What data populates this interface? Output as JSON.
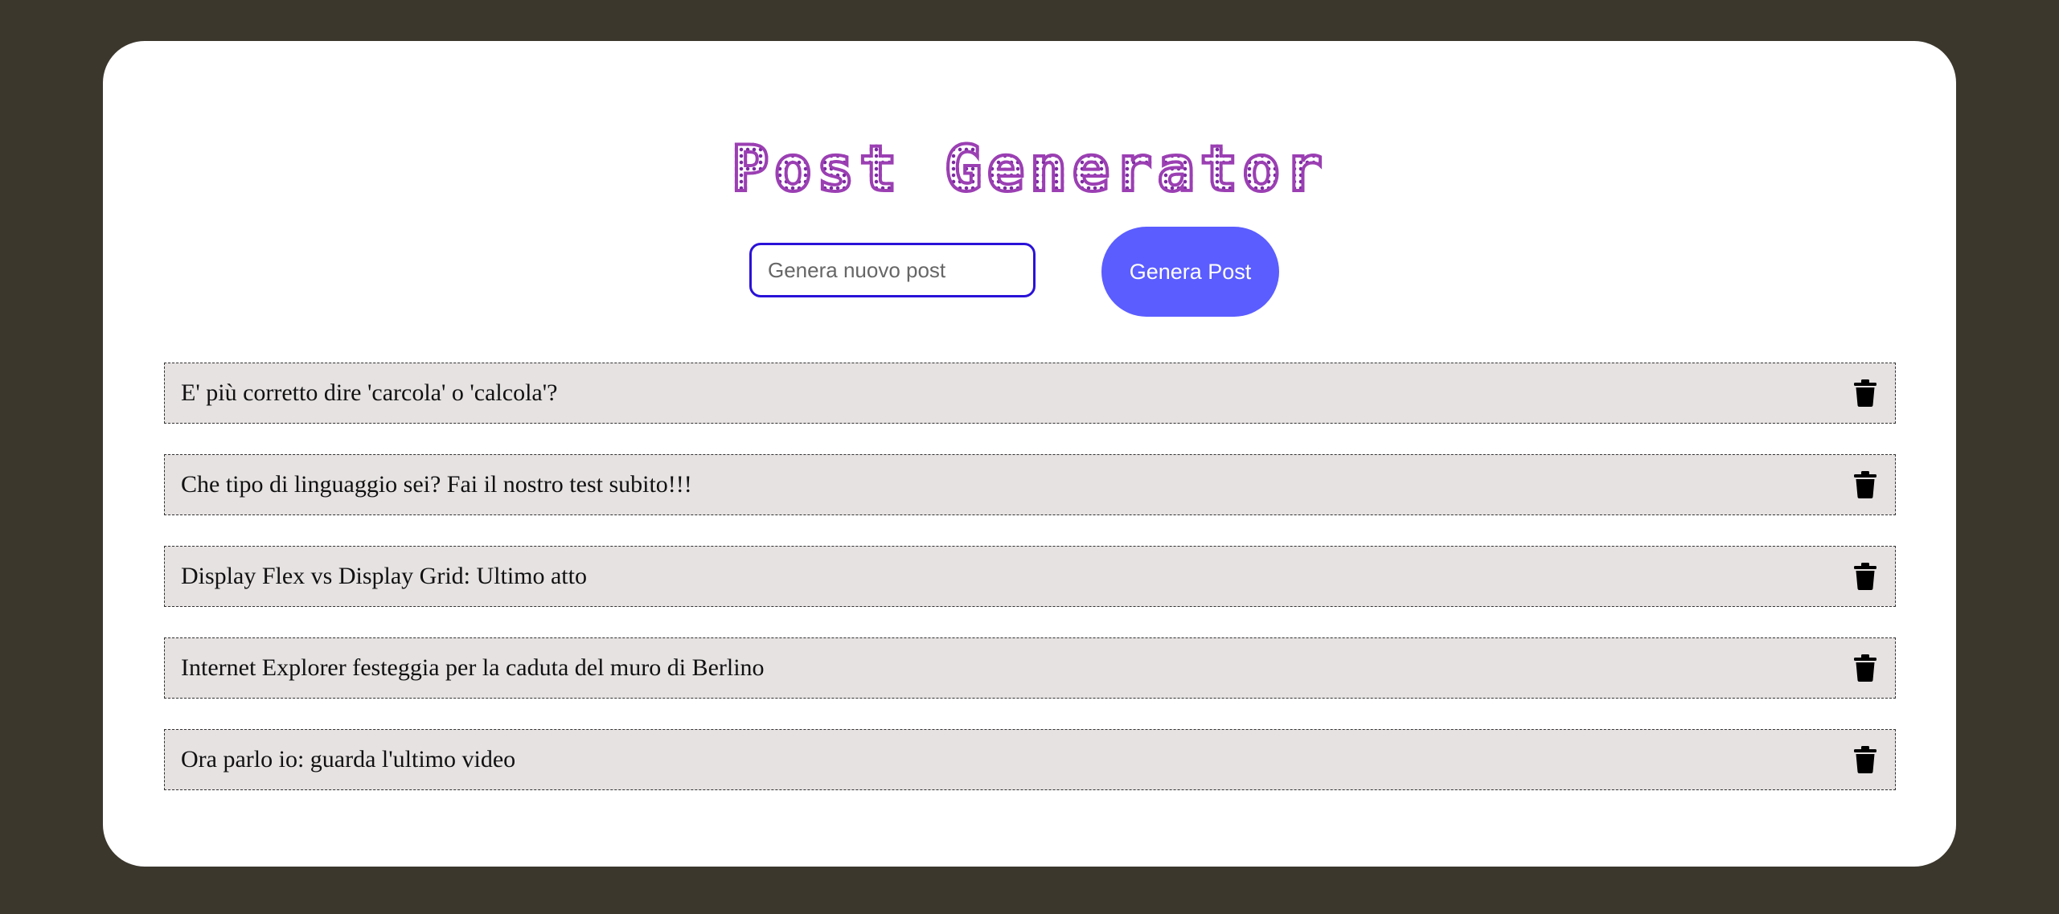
{
  "header": {
    "title": "Post Generator"
  },
  "form": {
    "input_value": "",
    "input_placeholder": "Genera nuovo post",
    "button_label": "Genera Post"
  },
  "posts": [
    {
      "text": "E' più corretto dire 'carcola' o 'calcola'?",
      "delete_icon": "trash-icon"
    },
    {
      "text": "Che tipo di linguaggio sei? Fai il nostro test subito!!!",
      "delete_icon": "trash-icon"
    },
    {
      "text": "Display Flex vs Display Grid: Ultimo atto",
      "delete_icon": "trash-icon"
    },
    {
      "text": "Internet Explorer festeggia per la caduta del muro di Berlino",
      "delete_icon": "trash-icon"
    },
    {
      "text": "Ora parlo io: guarda l'ultimo video",
      "delete_icon": "trash-icon"
    }
  ],
  "colors": {
    "page_background": "#3b372d",
    "card_background": "#ffffff",
    "title_color": "#9b3fb3",
    "button_background": "#5b5dff",
    "input_border": "#2a12d8",
    "post_background": "#e6e2e2"
  }
}
